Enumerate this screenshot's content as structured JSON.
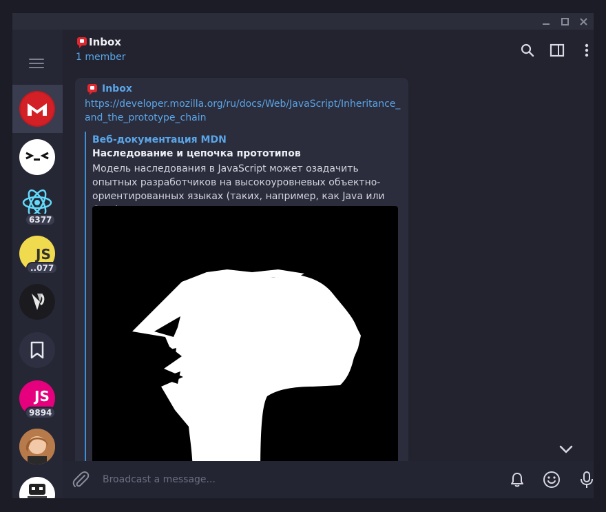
{
  "window": {
    "controls": [
      "minimize",
      "maximize",
      "close"
    ]
  },
  "sidebar": {
    "items": [
      {
        "name": "mail-avatar",
        "badge": "",
        "active": true
      },
      {
        "name": "face-avatar",
        "badge": ""
      },
      {
        "name": "react-avatar",
        "badge": "6377"
      },
      {
        "name": "js-avatar",
        "badge": "..077"
      },
      {
        "name": "vs-avatar",
        "badge": ""
      },
      {
        "name": "saved-messages",
        "badge": ""
      },
      {
        "name": "js-pink-avatar",
        "badge": "9894"
      },
      {
        "name": "person-avatar",
        "badge": ""
      },
      {
        "name": "robot-avatar",
        "badge": ""
      }
    ]
  },
  "header": {
    "title": "Inbox",
    "subtitle": "1 member"
  },
  "message": {
    "author": "Inbox",
    "link": "https://developer.mozilla.org/ru/docs/Web/JavaScript/Inheritance_and_the_prototype_chain",
    "preview": {
      "site": "Веб-документация MDN",
      "title": "Наследование и цепочка прототипов",
      "description": "Модель наследования в JavaScript может озадачить опытных разработчиков на высокоуровневых объектно-ориентированных языках (таких, например, как Java или C++)..."
    }
  },
  "composer": {
    "placeholder": "Broadcast a message..."
  },
  "colors": {
    "accent": "#5aa6e8",
    "background": "#22232f",
    "sidebar": "#262735"
  }
}
